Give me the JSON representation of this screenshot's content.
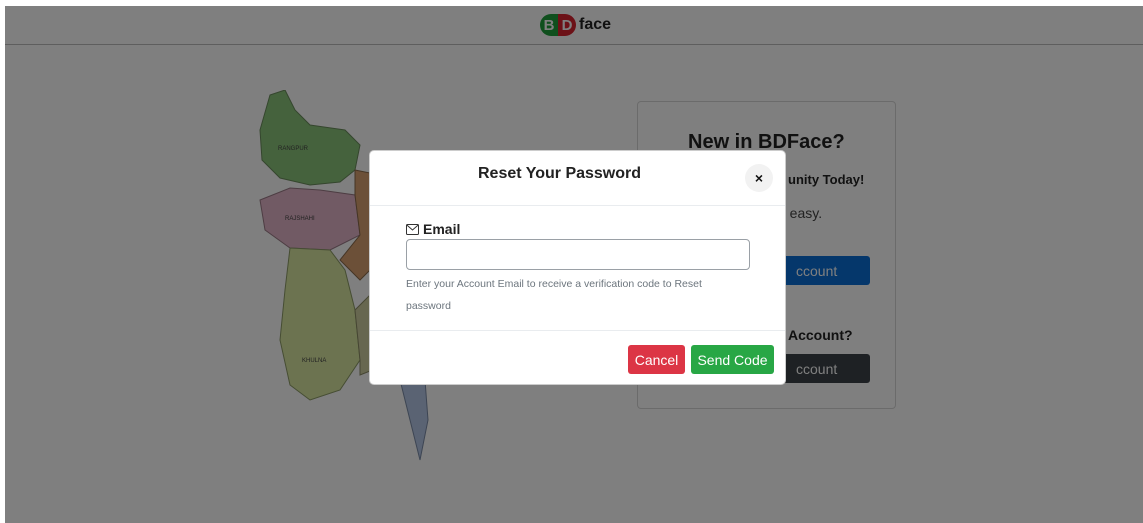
{
  "brand": {
    "letter_b": "B",
    "letter_d": "D",
    "text": "face",
    "colors": {
      "b": "#1f9e3a",
      "d": "#d9232f"
    }
  },
  "map": {
    "regions": [
      "RANGPUR",
      "RAJSHAHI",
      "KHULNA"
    ]
  },
  "card": {
    "title": "New in BDFace?",
    "subtitle_visible": "unity Today!",
    "note_visible": "d easy.",
    "primary_button_visible": "ccount",
    "question_visible": "Account?",
    "dark_button_visible": "ccount"
  },
  "modal": {
    "title": "Reset Your Password",
    "close_symbol": "×",
    "email_label": "Email",
    "email_value": "",
    "email_placeholder": "",
    "help_text": "Enter your Account Email to receive a verification code to Reset password",
    "cancel_label": "Cancel",
    "send_label": "Send Code"
  },
  "icons": {
    "email": "mail-icon",
    "close": "close-icon"
  },
  "colors": {
    "danger": "#dc3545",
    "success": "#28a745",
    "primary": "#0b6fd6",
    "dark": "#3d4349"
  }
}
